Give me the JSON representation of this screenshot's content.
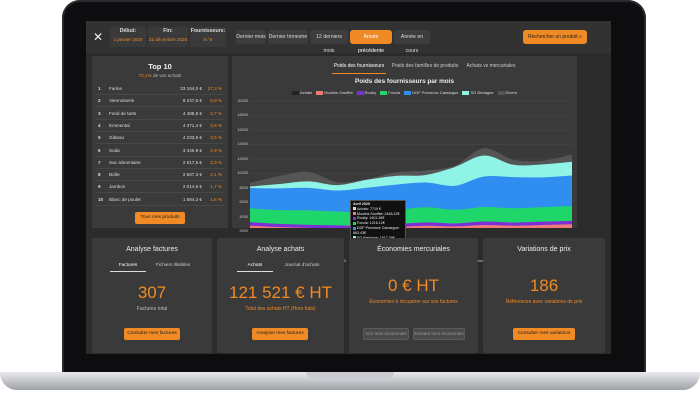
{
  "topbar": {
    "close_label": "✕",
    "start": {
      "label": "Début:",
      "value": "1 janvier 2020"
    },
    "end": {
      "label": "Fin:",
      "value": "31 décembre 2020"
    },
    "suppliers": {
      "label": "Fournisseurs:",
      "value": "8 / 8"
    },
    "periods": [
      "Dernier mois",
      "Dernier trimestre",
      "12 derniers mois",
      "Année précédente",
      "Année en cours"
    ],
    "active_period_index": 3,
    "search_label": "Rechercher un produit"
  },
  "top10": {
    "title": "Top 10",
    "subtitle_accent": "72,1%",
    "subtitle_rest": "de vos achats",
    "rows": [
      {
        "rank": "1",
        "name": "Farine",
        "amount": "33 164,0 €",
        "pct": "27,3 %"
      },
      {
        "rank": "2",
        "name": "Viennoiserie",
        "amount": "8 247,6 €",
        "pct": "6,8 %"
      },
      {
        "rank": "3",
        "name": "Fond de tarte",
        "amount": "4 488,8 €",
        "pct": "3,7 %"
      },
      {
        "rank": "4",
        "name": "Emmental",
        "amount": "4 371,4 €",
        "pct": "3,6 %"
      },
      {
        "rank": "5",
        "name": "Gâteau",
        "amount": "4 233,6 €",
        "pct": "3,5 %"
      },
      {
        "rank": "6",
        "name": "Soda",
        "amount": "3 446,8 €",
        "pct": "2,8 %"
      },
      {
        "rank": "7",
        "name": "Sac alimentaire",
        "amount": "2 817,5 €",
        "pct": "2,3 %"
      },
      {
        "rank": "8",
        "name": "Boîte",
        "amount": "2 567,3 €",
        "pct": "2,1 %"
      },
      {
        "rank": "9",
        "name": "Jambon",
        "amount": "2 014,6 €",
        "pct": "1,7 %"
      },
      {
        "rank": "10",
        "name": "Blanc de poulet",
        "amount": "1 884,3 €",
        "pct": "1,6 %"
      }
    ],
    "button_label": "Tous mes produits"
  },
  "chart_panel": {
    "tabs": [
      "Poids des fournisseurs",
      "Poids des familles de produits",
      "Achats vs mercuriales"
    ],
    "active_tab_index": 0
  },
  "chart_data": {
    "type": "area",
    "title": "Poids des fournisseurs par mois",
    "x": [
      "Janvier 2020",
      "Février 2020",
      "Mars 2020",
      "Avril 2020",
      "Mai 2020",
      "Juin 2020",
      "Juillet 2020",
      "Août 2020",
      "Septembre 2020",
      "Octobre 2020",
      "Novembre 2020",
      "Décembre 2020"
    ],
    "ylim": [
      0,
      20000
    ],
    "yticks": [
      0,
      2000,
      4000,
      6000,
      8000,
      10000,
      12000,
      14000,
      16000,
      18000,
      20000
    ],
    "legend_position": "top",
    "legend_line": {
      "name": "Achats",
      "color": "#222222"
    },
    "series": [
      {
        "name": "Moulins Soufflet",
        "color": "#f07a7a",
        "values": [
          2800,
          2600,
          2500,
          2450,
          2400,
          2600,
          2800,
          2700,
          2900,
          2800,
          2900,
          3000
        ]
      },
      {
        "name": "Rouby",
        "color": "#7d2fd6",
        "values": [
          500,
          450,
          420,
          400,
          380,
          420,
          450,
          400,
          480,
          450,
          460,
          470
        ]
      },
      {
        "name": "Foncia",
        "color": "#1fd66a",
        "values": [
          1900,
          1900,
          2000,
          1900,
          1850,
          1950,
          2100,
          1900,
          2000,
          1950,
          2000,
          2050
        ]
      },
      {
        "name": "DGF Provence Camargue",
        "color": "#2f8ef0",
        "values": [
          2800,
          3000,
          3100,
          2900,
          3400,
          3500,
          3400,
          3300,
          4200,
          4300,
          4100,
          4200
        ]
      },
      {
        "name": "SG Bretagne",
        "color": "#8ff3e6",
        "values": [
          200,
          600,
          900,
          750,
          1100,
          1200,
          1050,
          2600,
          2900,
          1700,
          1800,
          1900
        ]
      },
      {
        "name": "Divers",
        "color": "#555555",
        "values": [
          500,
          1100,
          1300,
          400,
          100,
          500,
          600,
          200,
          1000,
          700,
          500,
          1000
        ]
      }
    ],
    "tooltip": {
      "title": "Avril 2020",
      "rows": [
        {
          "label": "Achats: 7719 €",
          "color": "#dddddd"
        },
        {
          "label": "Moulins Soufflet: 2448.12€",
          "color": "#f07a7a"
        },
        {
          "label": "Rouby: 1401.36€",
          "color": "#7d2fd6"
        },
        {
          "label": "Foncia: 1216.12€",
          "color": "#1fd66a"
        },
        {
          "label": "DGF Provence Camargue: 863.43€",
          "color": "#2f8ef0"
        },
        {
          "label": "SG Bretagne: 1517.38€",
          "color": "#8ff3e6"
        },
        {
          "label": "Divers: 596.32€",
          "color": "#555555"
        }
      ]
    }
  },
  "cards": [
    {
      "title": "Analyse factures",
      "tabs": [
        "Factures",
        "Fichiers illisibles"
      ],
      "value": "307",
      "caption": "Factures total",
      "caption_muted": true,
      "buttons": [
        {
          "label": "Consulter mes factures",
          "style": "orange"
        }
      ]
    },
    {
      "title": "Analyse achats",
      "tabs": [
        "Achats",
        "Journal d'achats"
      ],
      "value": "121 521 € HT",
      "caption": "Total des achats HT (Hors frais)",
      "caption_muted": false,
      "buttons": [
        {
          "label": "Analyser mes factures",
          "style": "orange"
        }
      ]
    },
    {
      "title": "Économies mercuriales",
      "tabs": [],
      "value": "0 € HT",
      "caption": "Économies à récupérer sur vos factures",
      "caption_muted": false,
      "buttons": [
        {
          "label": "Voir mes économies",
          "style": "grey"
        },
        {
          "label": "Extraire mes économies",
          "style": "grey"
        }
      ]
    },
    {
      "title": "Variations de prix",
      "tabs": [],
      "value": "186",
      "caption": "Références avec variations de prix",
      "caption_muted": false,
      "buttons": [
        {
          "label": "Consulter mes variations",
          "style": "orange"
        }
      ]
    }
  ]
}
